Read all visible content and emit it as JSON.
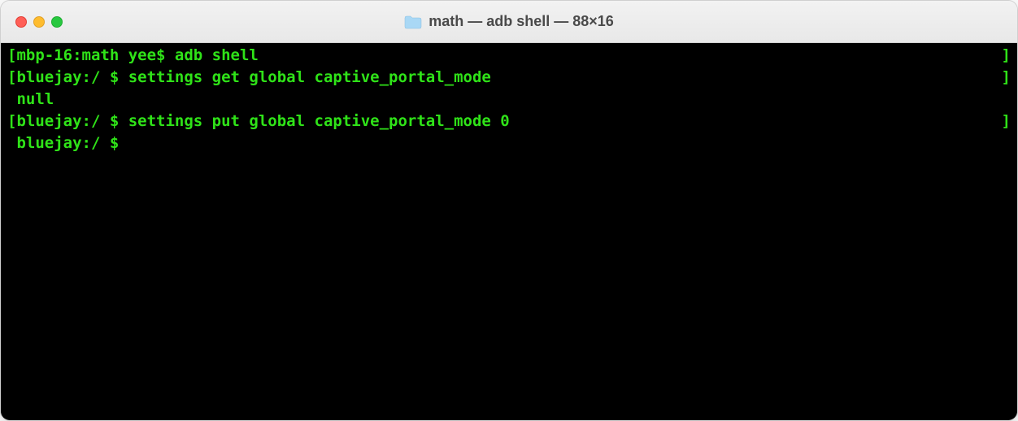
{
  "window": {
    "title": "math — adb shell — 88×16"
  },
  "terminal": {
    "lines": [
      {
        "left_bracket": "[",
        "content": "mbp-16:math yee$ adb shell",
        "right_bracket": "]"
      },
      {
        "left_bracket": "[",
        "content": "bluejay:/ $ settings get global captive_portal_mode",
        "right_bracket": "]"
      },
      {
        "left_bracket": " ",
        "content": "null",
        "right_bracket": ""
      },
      {
        "left_bracket": "[",
        "content": "bluejay:/ $ settings put global captive_portal_mode 0",
        "right_bracket": "]"
      },
      {
        "left_bracket": " ",
        "content": "bluejay:/ $ ",
        "right_bracket": ""
      }
    ]
  }
}
